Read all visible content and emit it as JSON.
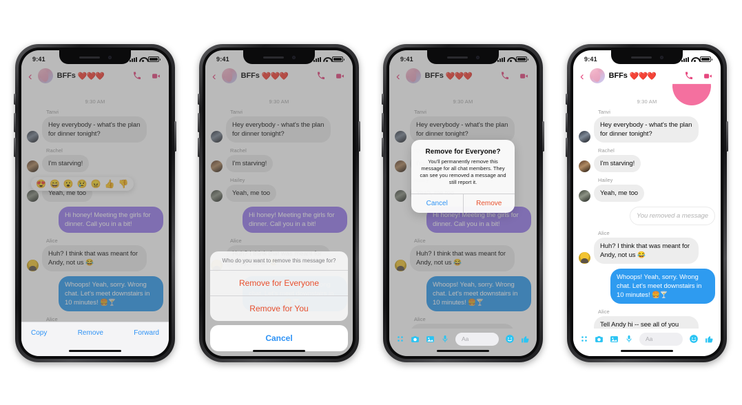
{
  "common": {
    "status_time": "9:41",
    "chat_title": "BFFs",
    "chat_hearts": "❤️❤️❤️",
    "timestamp": "9:30 AM",
    "back_icon": "‹",
    "composer_placeholder": "Aa"
  },
  "messages": {
    "m1_sender": "Tanvi",
    "m1_text": "Hey everybody - what's the plan for dinner tonight?",
    "m2_sender": "Rachel",
    "m2_text": "I'm starving!",
    "m3_sender": "Hailey",
    "m3_text": "Yeah, me too",
    "m4_text": "Hi honey! Meeting the girls for dinner. Call you in a bit!",
    "m5_sender": "Alice",
    "m5_text": "Huh? I think that was meant for Andy, not us 😂",
    "m6_text": "Whoops! Yeah, sorry. Wrong chat. Let's meet downstairs in 10 minutes! 🍔🍸",
    "m7_sender": "Alice",
    "m7_text": "Tell Andy hi -- see all of you soon! 🍔",
    "removed_notice": "You removed a message"
  },
  "reactions": {
    "emojis": [
      "😍",
      "😄",
      "😮",
      "😢",
      "😠",
      "👍",
      "👎"
    ]
  },
  "phone1": {
    "actions": {
      "copy": "Copy",
      "remove": "Remove",
      "forward": "Forward"
    }
  },
  "phone2": {
    "sheet": {
      "title": "Who do you want to remove this message for?",
      "remove_everyone": "Remove for Everyone",
      "remove_you": "Remove for You",
      "cancel": "Cancel"
    }
  },
  "phone3": {
    "alert": {
      "title": "Remove for Everyone?",
      "message": "You'll permanently remove this message for all chat members. They can see you removed a message and still report it.",
      "cancel": "Cancel",
      "remove": "Remove"
    }
  },
  "colors": {
    "accent_pink": "#e6487f",
    "bubble_in": "#ededed",
    "bubble_purple": "#9a7df0",
    "bubble_blue": "#2e9bf0",
    "link_blue": "#2f93f5",
    "destructive_red": "#e8502e",
    "composer_cyan": "#2bc4f3"
  }
}
